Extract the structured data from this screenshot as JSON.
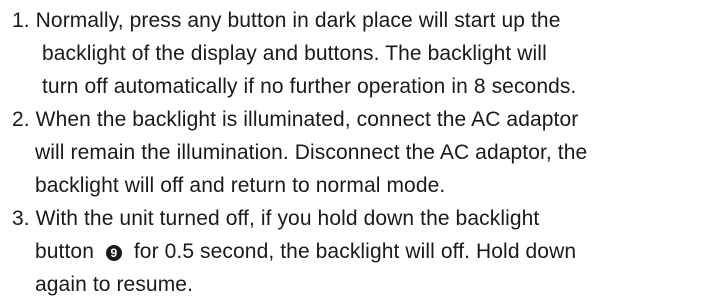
{
  "instructions": {
    "item1": {
      "number": "1.",
      "line1": "Normally, press any button in dark place will start up the",
      "line2": "backlight of  the display and buttons. The backlight will",
      "line3": "turn off automatically if no further operation in 8 seconds."
    },
    "item2": {
      "number": "2.",
      "line1": "When the backlight is illuminated, connect the AC adaptor",
      "line2": "will remain the illumination. Disconnect the AC adaptor, the",
      "line3": "backlight will off and return to normal mode."
    },
    "item3": {
      "number": "3.",
      "line1": "With the unit turned off, if you hold down the backlight",
      "line2_before": "button",
      "button_symbol": "9",
      "line2_after": "for 0.5 second, the backlight will off. Hold down",
      "line3": "again to resume."
    }
  }
}
